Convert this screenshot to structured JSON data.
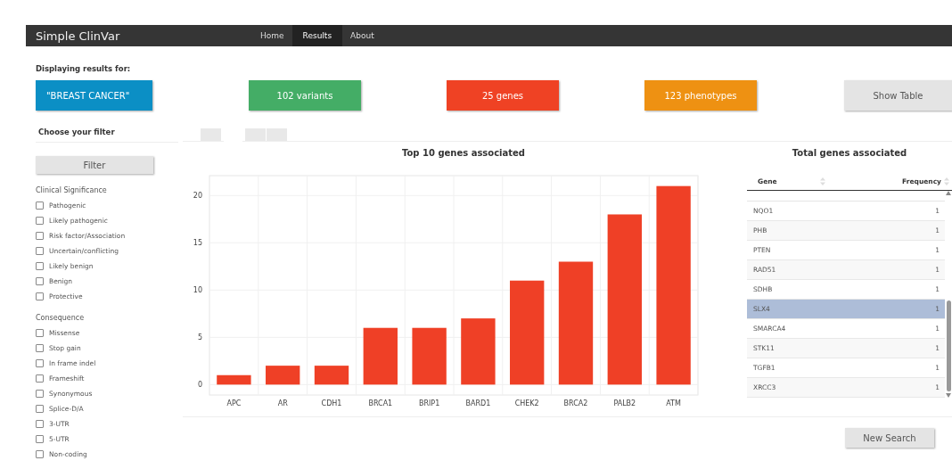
{
  "navbar": {
    "brand": "Simple ClinVar",
    "items": [
      {
        "label": "Home",
        "selected": false
      },
      {
        "label": "Results",
        "selected": true
      },
      {
        "label": "About",
        "selected": false
      }
    ]
  },
  "summary": {
    "heading": "Displaying results for:",
    "boxes": [
      {
        "kind": "query",
        "text": "\"BREAST CANCER\"",
        "color": "#0b8fc5"
      },
      {
        "kind": "count",
        "text": "102 variants",
        "color": "#44ad66"
      },
      {
        "kind": "count",
        "text": "25 genes",
        "color": "#ef4224"
      },
      {
        "kind": "count",
        "text": "123 phenotypes",
        "color": "#ee9112"
      }
    ],
    "show_table_button": "Show Table"
  },
  "sidebar": {
    "title": "Choose your filter",
    "filter_button": "Filter",
    "groups": [
      {
        "title": "Clinical Significance",
        "options": [
          {
            "label": "Pathogenic",
            "checked": false
          },
          {
            "label": "Likely pathogenic",
            "checked": false
          },
          {
            "label": "Risk factor/Association",
            "checked": false
          },
          {
            "label": "Uncertain/conflicting",
            "checked": false
          },
          {
            "label": "Likely benign",
            "checked": false
          },
          {
            "label": "Benign",
            "checked": false
          },
          {
            "label": "Protective",
            "checked": false
          }
        ]
      },
      {
        "title": "Consequence",
        "options": [
          {
            "label": "Missense",
            "checked": false
          },
          {
            "label": "Stop gain",
            "checked": false
          },
          {
            "label": "In frame indel",
            "checked": false
          },
          {
            "label": "Frameshift",
            "checked": false
          },
          {
            "label": "Synonymous",
            "checked": false
          },
          {
            "label": "Splice-D/A",
            "checked": false
          },
          {
            "label": "3-UTR",
            "checked": false
          },
          {
            "label": "5-UTR",
            "checked": false
          },
          {
            "label": "Non-coding",
            "checked": false
          }
        ]
      }
    ]
  },
  "tabs": [
    {
      "selected": false
    },
    {
      "selected": true
    },
    {
      "selected": false
    },
    {
      "selected": false
    }
  ],
  "chart": {
    "title": "Top 10 genes associated",
    "chart_data": {
      "type": "bar",
      "categories": [
        "APC",
        "AR",
        "CDH1",
        "BRCA1",
        "BRIP1",
        "BARD1",
        "CHEK2",
        "BRCA2",
        "PALB2",
        "ATM"
      ],
      "grid": true,
      "series": [
        {
          "color": "#ef4026",
          "values": [
            1,
            2,
            2,
            6,
            6,
            7,
            11,
            13,
            18,
            21
          ]
        }
      ],
      "ylim": [
        -1.1,
        22.1
      ],
      "yticks": [
        0,
        5,
        10,
        15,
        20
      ]
    }
  },
  "gene_table": {
    "title": "Total genes associated",
    "columns": [
      "Gene",
      "Frequency"
    ],
    "rows": [
      {
        "gene": "NQO1",
        "frequency": "1",
        "selected": false
      },
      {
        "gene": "PHB",
        "frequency": "1",
        "selected": false
      },
      {
        "gene": "PTEN",
        "frequency": "1",
        "selected": false
      },
      {
        "gene": "RAD51",
        "frequency": "1",
        "selected": false
      },
      {
        "gene": "SDHB",
        "frequency": "1",
        "selected": false
      },
      {
        "gene": "SLX4",
        "frequency": "1",
        "selected": true
      },
      {
        "gene": "SMARCA4",
        "frequency": "1",
        "selected": false
      },
      {
        "gene": "STK11",
        "frequency": "1",
        "selected": false
      },
      {
        "gene": "TGFB1",
        "frequency": "1",
        "selected": false
      },
      {
        "gene": "XRCC3",
        "frequency": "1",
        "selected": false
      }
    ]
  },
  "new_search_button": "New Search"
}
